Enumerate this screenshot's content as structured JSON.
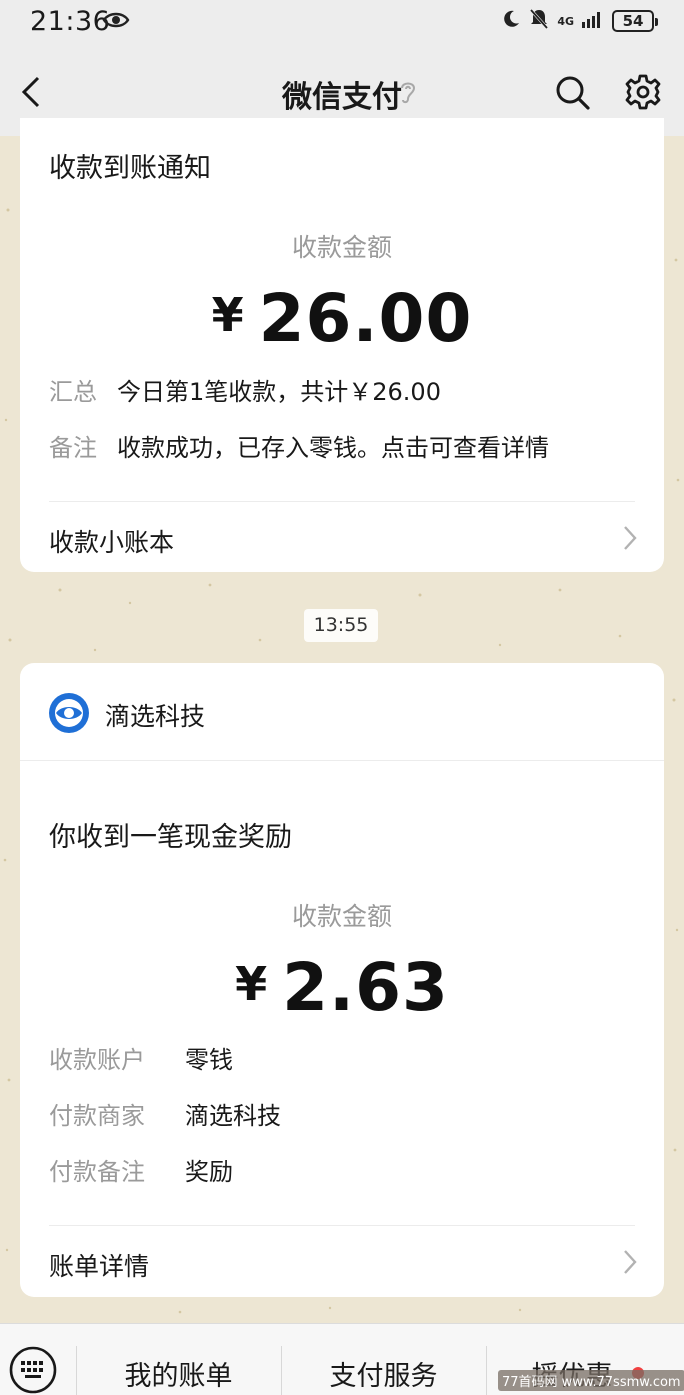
{
  "status_bar": {
    "time": "21:36",
    "network": "4G",
    "battery": "54"
  },
  "nav": {
    "title": "微信支付"
  },
  "message1": {
    "title": "收款到账通知",
    "amount_label": "收款金额",
    "currency": "¥",
    "amount": "26.00",
    "rows": [
      {
        "key": "汇总",
        "value": "今日第1笔收款，共计￥26.00"
      },
      {
        "key": "备注",
        "value": "收款成功，已存入零钱。点击可查看详情"
      }
    ],
    "link_label": "收款小账本"
  },
  "timestamp": "13:55",
  "message2": {
    "merchant": "滴选科技",
    "title": "你收到一笔现金奖励",
    "amount_label": "收款金额",
    "currency": "¥",
    "amount": "2.63",
    "rows": [
      {
        "key": "收款账户",
        "value": "零钱"
      },
      {
        "key": "付款商家",
        "value": "滴选科技"
      },
      {
        "key": "付款备注",
        "value": "奖励"
      }
    ],
    "link_label": "账单详情"
  },
  "bottom_menu": {
    "items": [
      "我的账单",
      "支付服务",
      "摇优惠"
    ]
  },
  "watermark": "77首码网 www.77ssmw.com",
  "icons": {
    "back": "chevron-left-icon",
    "ear": "ear-icon",
    "search": "search-icon",
    "settings": "gear-icon",
    "keyboard": "keyboard-icon",
    "merchant_logo": "eye-logo-icon"
  },
  "colors": {
    "background": "#ede6d3",
    "card": "#ffffff",
    "muted_text": "#9a9a9a",
    "merchant_logo": "#1f6fd6",
    "notification_dot": "#f04040"
  }
}
